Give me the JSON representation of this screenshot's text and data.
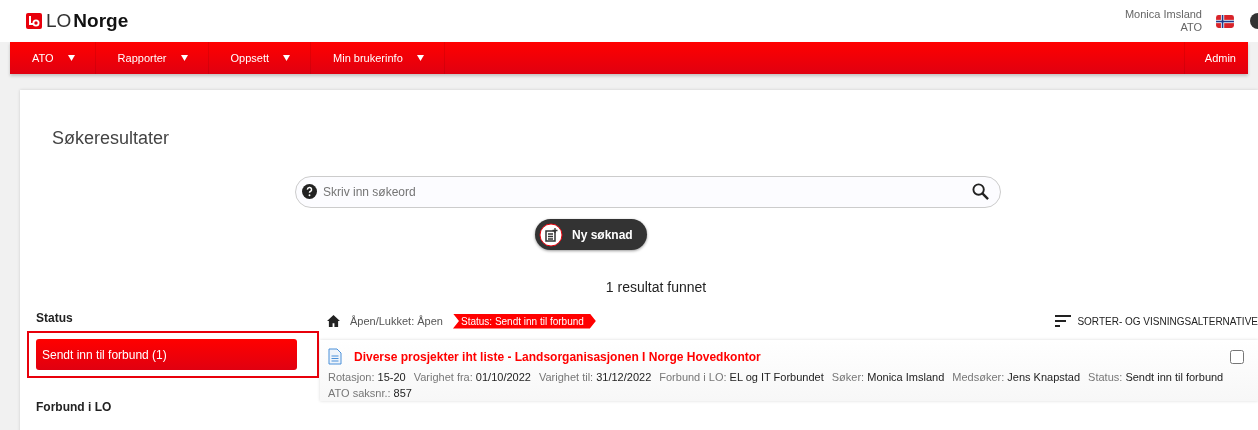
{
  "header": {
    "logo_light": "LO",
    "logo_bold": "Norge",
    "user_name": "Monica Imsland",
    "user_role": "ATO"
  },
  "nav": {
    "items": [
      {
        "label": "ATO",
        "dropdown": true
      },
      {
        "label": "Rapporter",
        "dropdown": true
      },
      {
        "label": "Oppsett",
        "dropdown": true
      },
      {
        "label": "Min brukerinfo",
        "dropdown": true
      }
    ],
    "right": "Admin"
  },
  "page_title": "Søkeresultater",
  "search": {
    "placeholder": "Skriv inn søkeord"
  },
  "new_button": "Ny søknad",
  "result_count": "1 resultat funnet",
  "filters": [
    {
      "heading": "Status",
      "items": [
        {
          "label": "Sendt inn til forbund (1)",
          "selected": true
        }
      ]
    },
    {
      "heading": "Forbund i LO"
    }
  ],
  "breadcrumb": [
    {
      "label": "Åpen/Lukket: Åpen",
      "active": false
    },
    {
      "label": "Status: Sendt inn til forbund",
      "active": true
    }
  ],
  "sort_label": "SORTER- OG VISNINGSALTERNATIVE",
  "results": [
    {
      "title": "Diverse prosjekter iht liste - Landsorganisasjonen I Norge Hovedkontor",
      "checked": false,
      "fields": [
        {
          "label": "Rotasjon:",
          "value": "15-20"
        },
        {
          "label": "Varighet fra:",
          "value": "01/10/2022"
        },
        {
          "label": "Varighet til:",
          "value": "31/12/2022"
        },
        {
          "label": "Forbund i LO:",
          "value": "EL og IT Forbundet"
        },
        {
          "label": "Søker:",
          "value": "Monica Imsland"
        },
        {
          "label": "Medsøker:",
          "value": "Jens Knapstad"
        },
        {
          "label": "Status:",
          "value": "Sendt inn til forbund"
        },
        {
          "label": "ATO saksnr.:",
          "value": "857"
        }
      ]
    }
  ]
}
